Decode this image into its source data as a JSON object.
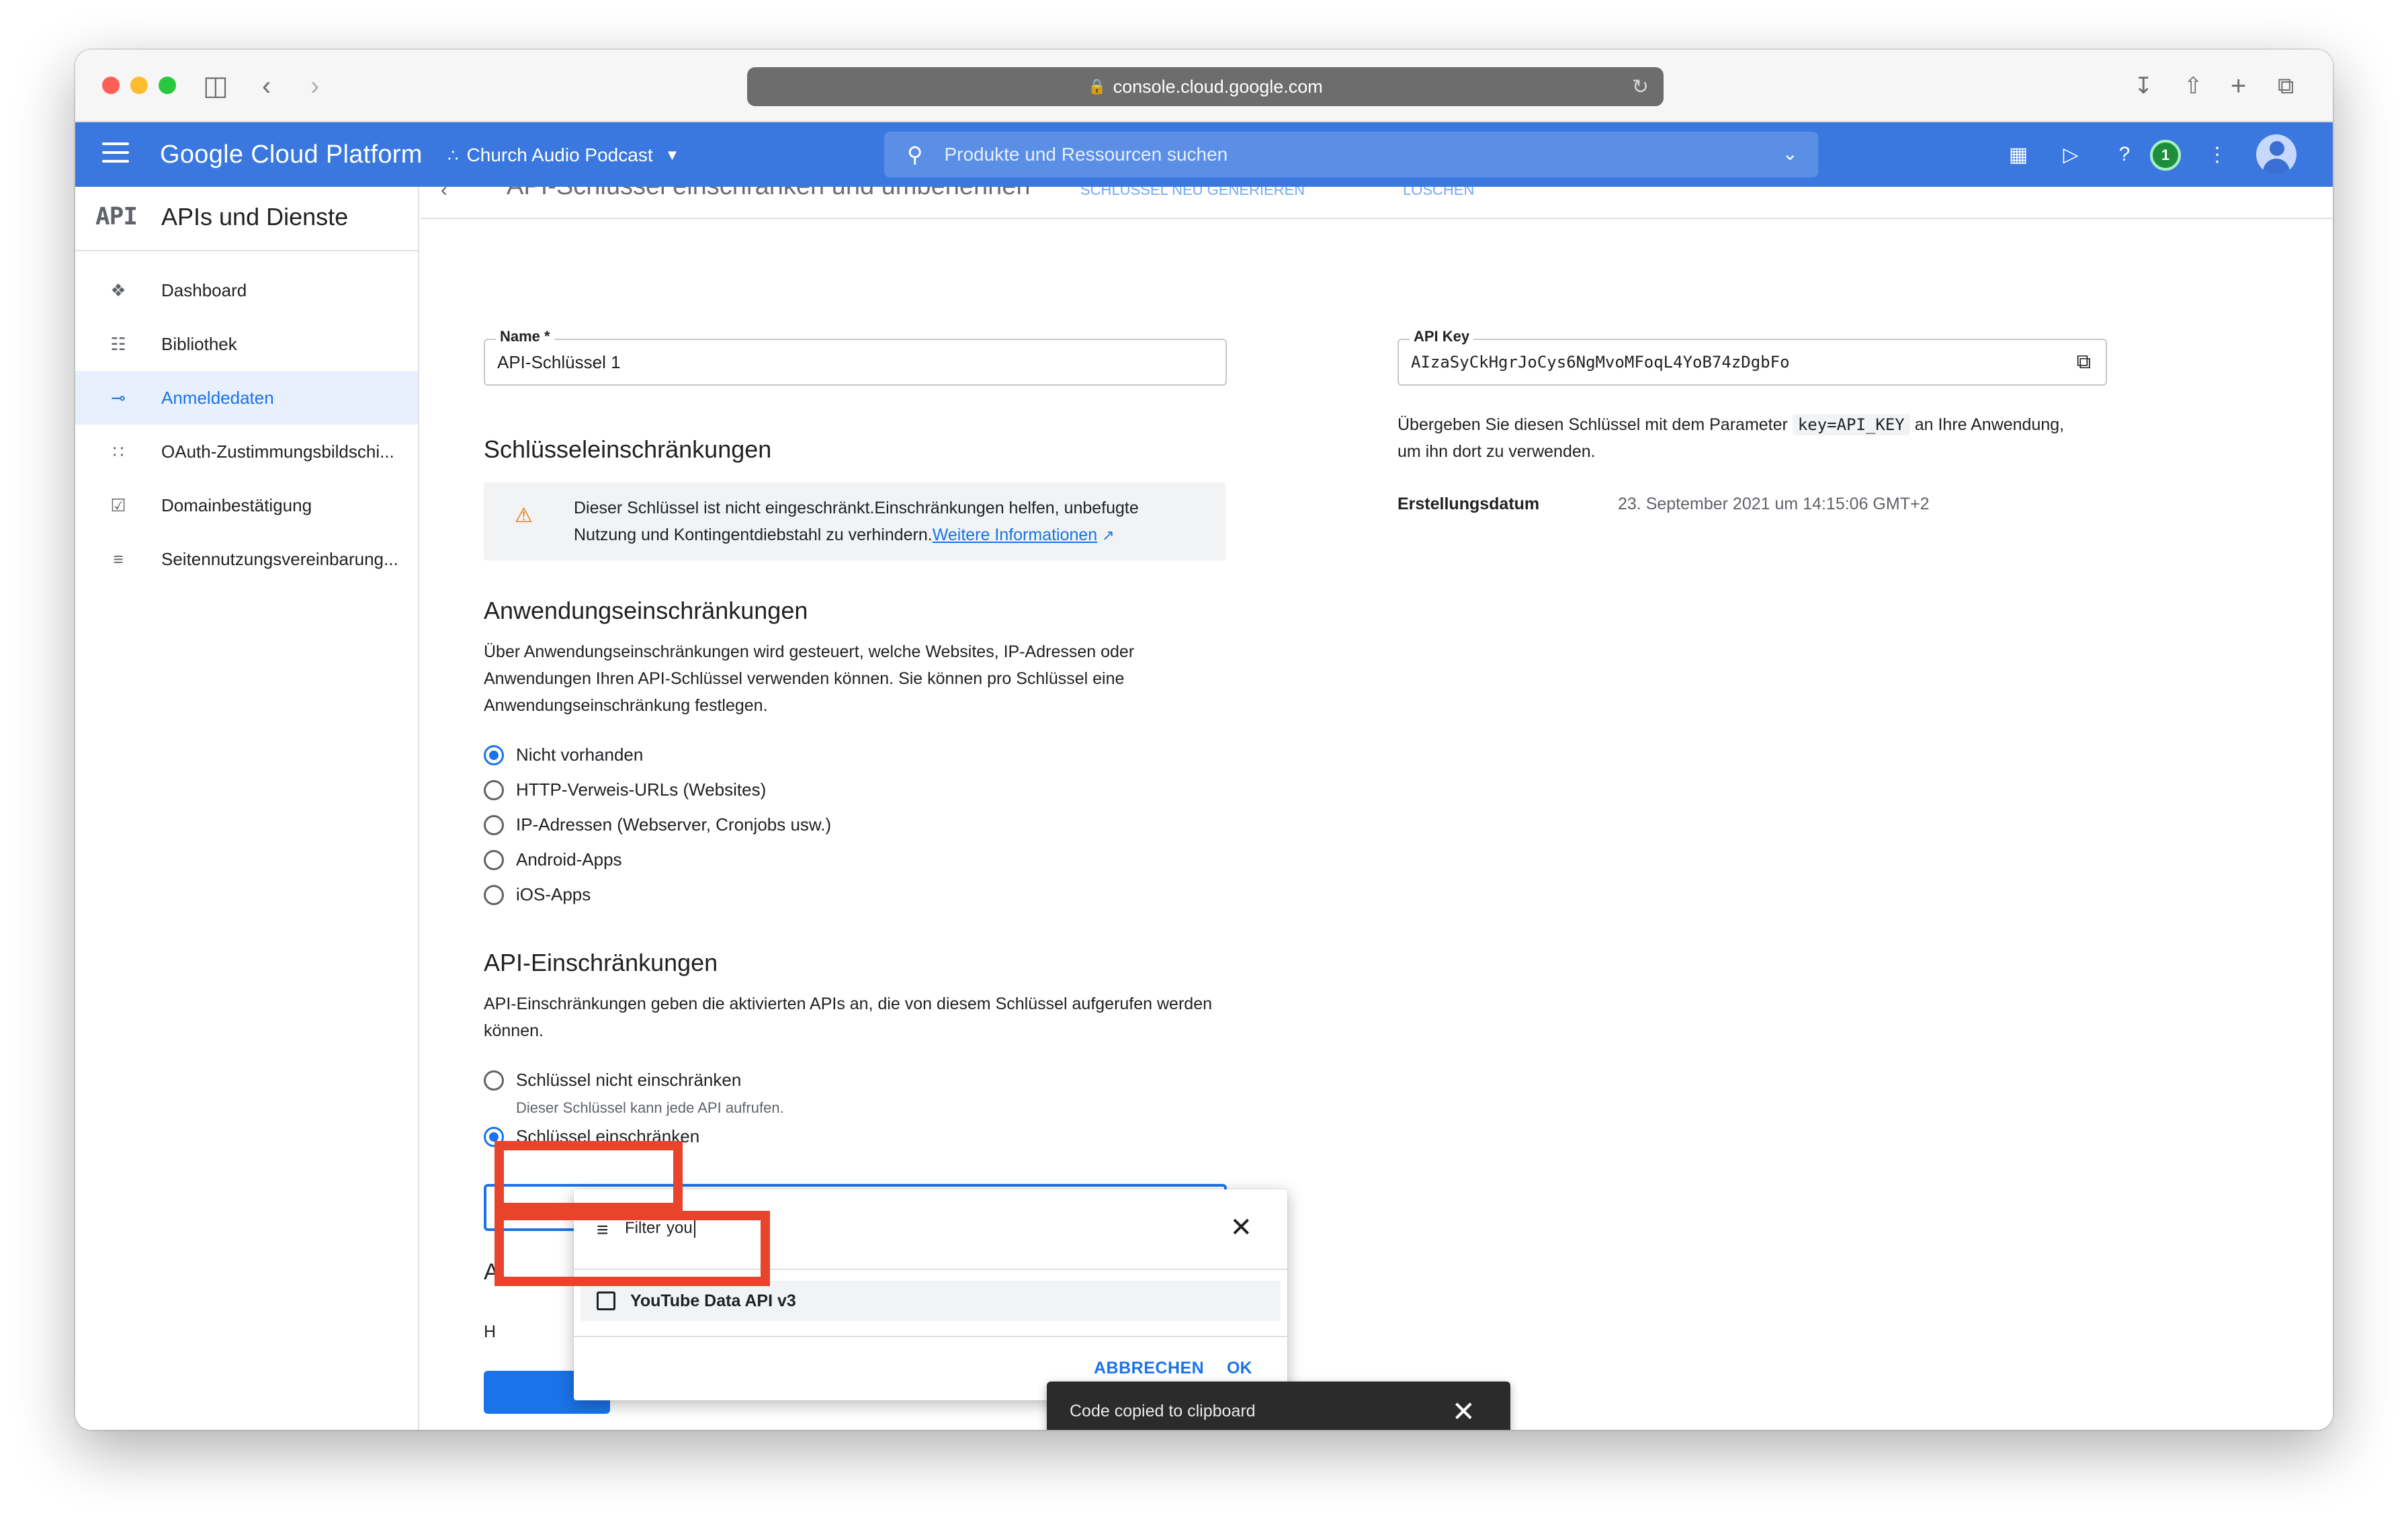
{
  "browser": {
    "url": "console.cloud.google.com"
  },
  "header": {
    "brand": "Google Cloud Platform",
    "project": "Church Audio Podcast",
    "search_placeholder": "Produkte und Ressourcen suchen",
    "notification_count": "1"
  },
  "sidebar": {
    "logo": "API",
    "title": "APIs und Dienste",
    "items": [
      {
        "label": "Dashboard",
        "icon": "dashboard-icon"
      },
      {
        "label": "Bibliothek",
        "icon": "library-icon"
      },
      {
        "label": "Anmeldedaten",
        "icon": "key-icon"
      },
      {
        "label": "OAuth-Zustimmungsbildschi...",
        "icon": "oauth-icon"
      },
      {
        "label": "Domainbestätigung",
        "icon": "domain-check-icon"
      },
      {
        "label": "Seitennutzungsvereinbarung...",
        "icon": "page-usage-icon"
      }
    ],
    "active_index": 2,
    "collapse_label": "<I"
  },
  "page": {
    "title": "API-Schlüssel einschränken und umbenennen",
    "action_regenerate": "SCHLÜSSEL NEU GENERIEREN",
    "action_delete": "LÖSCHEN",
    "name_label": "Name *",
    "name_value": "API-Schlüssel 1",
    "key_restrictions_heading": "Schlüsseleinschränkungen",
    "warning_text": "Dieser Schlüssel ist nicht eingeschränkt.Einschränkungen helfen, unbefugte Nutzung und Kontingentdiebstahl zu verhindern.",
    "warning_link": "Weitere Informationen",
    "app_restrictions_heading": "Anwendungseinschränkungen",
    "app_restrictions_desc": "Über Anwendungseinschränkungen wird gesteuert, welche Websites, IP-Adressen oder Anwendungen Ihren API-Schlüssel verwenden können. Sie können pro Schlüssel eine Anwendungseinschränkung festlegen.",
    "app_options": [
      "Nicht vorhanden",
      "HTTP-Verweis-URLs (Websites)",
      "IP-Adressen (Webserver, Cronjobs usw.)",
      "Android-Apps",
      "iOS-Apps"
    ],
    "app_selected": 0,
    "api_restrictions_heading": "API-Einschränkungen",
    "api_restrictions_desc": "API-Einschränkungen geben die aktivierten APIs an, die von diesem Schlüssel aufgerufen werden können.",
    "api_option_none": "Schlüssel nicht einschränken",
    "api_option_none_sub": "Dieser Schlüssel kann jede API aufrufen.",
    "api_option_restrict": "Schlüssel einschränken",
    "behind_heading_letter": "A",
    "behind_text_letter": "H"
  },
  "right": {
    "api_key_label": "API Key",
    "api_key_value": "AIzaSyCkHgrJoCys6NgMvoMFoqL4YoB74zDgbFo",
    "usage_text_1": "Übergeben Sie diesen Schlüssel mit dem Parameter",
    "usage_code": "key=API_KEY",
    "usage_text_2": "an Ihre Anwendung,",
    "usage_text_3": "um ihn dort zu verwenden.",
    "created_label": "Erstellungsdatum",
    "created_value": "23. September 2021 um 14:15:06 GMT+2"
  },
  "dropdown": {
    "filter_label": "Filter",
    "filter_value": "you",
    "option_label": "YouTube Data API v3",
    "cancel_label": "ABBRECHEN",
    "ok_label": "OK"
  },
  "toast": {
    "message": "Code copied to clipboard"
  },
  "colors": {
    "header_blue": "#3a78e0",
    "accent": "#1a73e8",
    "highlight": "#e8432b",
    "warning": "#e37400"
  }
}
